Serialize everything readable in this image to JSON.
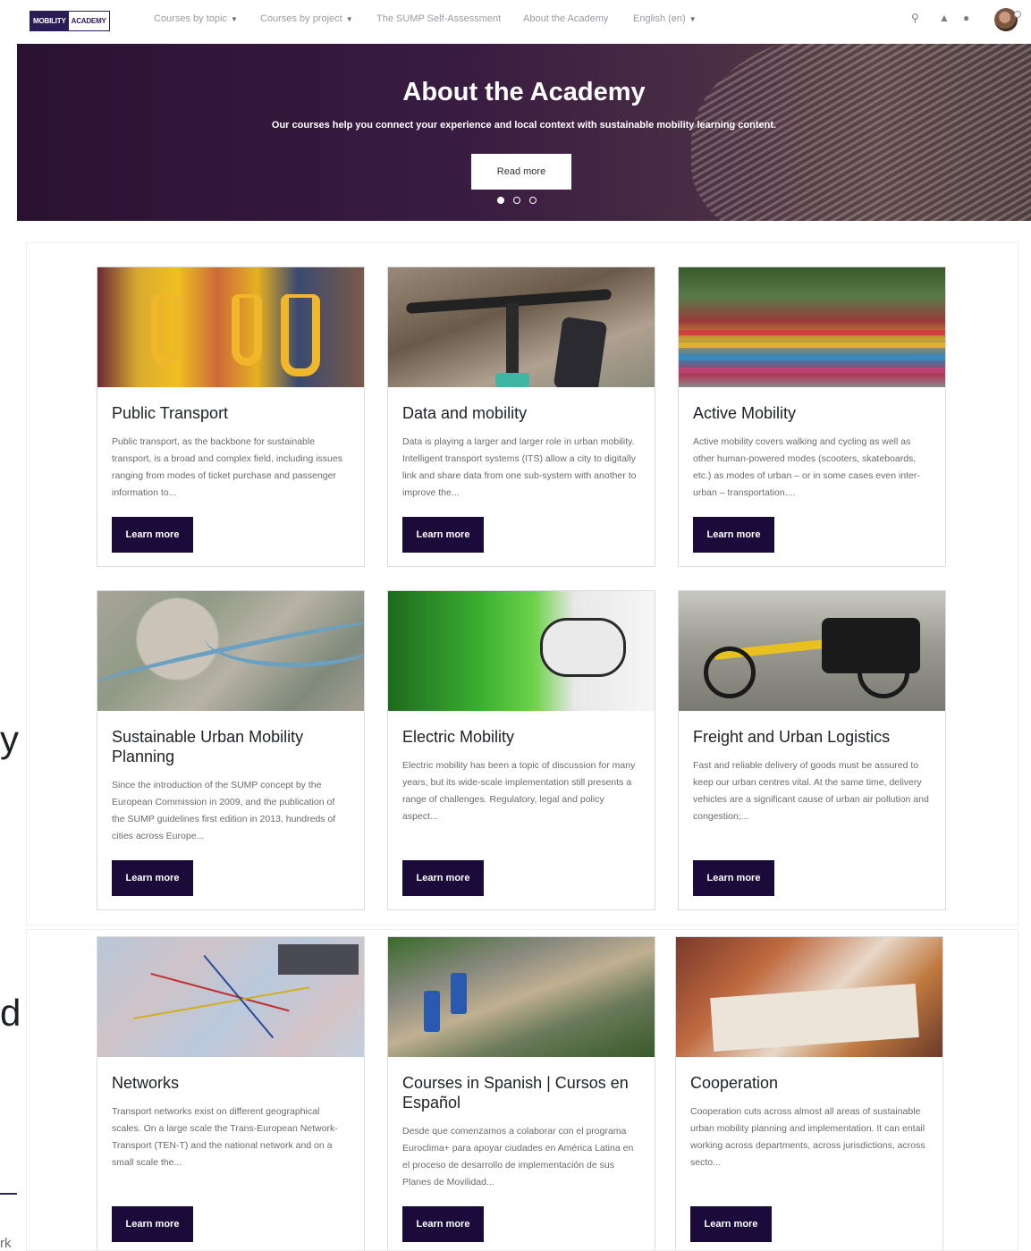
{
  "nav": {
    "logo_part1": "MOBILITY",
    "logo_part2": "ACADEMY",
    "items": [
      {
        "label": "Courses by topic",
        "caret": "▼"
      },
      {
        "label": "Courses by project",
        "caret": "▼"
      },
      {
        "label": "The SUMP Self-Assessment"
      },
      {
        "label": "About the Academy"
      },
      {
        "label": "English (en)",
        "caret": "▼"
      }
    ],
    "icons": [
      "search-icon",
      "bell-icon",
      "chat-icon"
    ]
  },
  "hero": {
    "title": "About the Academy",
    "subtitle": "Our courses help you connect your experience and local context with sustainable mobility learning content.",
    "button": "Read more",
    "slides": 3,
    "active_slide": 1
  },
  "courses": [
    {
      "title": "Public Transport",
      "description": "Public transport, as the backbone for sustainable transport, is a broad and complex field, including issues ranging from modes of ticket purchase and passenger information to...",
      "button": "Learn more"
    },
    {
      "title": "Data and mobility",
      "description": "Data is playing a larger and larger role in urban mobility. Intelligent transport systems (ITS) allow a city to digitally link and share data from one sub-system with another to improve the...",
      "button": "Learn more"
    },
    {
      "title": "Active Mobility",
      "description": "Active mobility covers walking and cycling as well as other human-powered modes (scooters, skateboards, etc.) as modes of urban – or in some cases even inter-urban – transportation....",
      "button": "Learn more"
    },
    {
      "title": "Sustainable Urban Mobility Planning",
      "description": "Since the introduction of the SUMP concept by the European Commission in 2009, and the publication of the SUMP guidelines first edition in 2013, hundreds of cities across Europe...",
      "button": "Learn more"
    },
    {
      "title": "Electric Mobility",
      "description": "Electric mobility has been a topic of discussion for many years, but its wide-scale implementation still presents a range of challenges. Regulatory, legal and policy aspect...",
      "button": "Learn more"
    },
    {
      "title": "Freight and Urban Logistics",
      "description": "Fast and reliable delivery of goods must be assured to keep our urban centres vital. At the same time, delivery vehicles are a significant cause of urban air pollution and congestion;...",
      "button": "Learn more"
    },
    {
      "title": "Networks",
      "description": "Transport networks exist on different geographical scales. On a large scale the Trans-European Network-Transport (TEN-T) and the national network and on a small scale the...",
      "button": "Learn more"
    },
    {
      "title": "Courses in Spanish | Cursos en Español",
      "description": "Desde que comenzamos a colaborar con el programa Euroclima+ para apoyar ciudades en América Latina en el proceso de desarrollo de implementación de sus Planes de Movilidad...",
      "button": "Learn more"
    },
    {
      "title": "Cooperation",
      "description": "Cooperation cuts across almost all areas of sustainable urban mobility planning and implementation. It can entail working across departments, across jurisdictions, across secto...",
      "button": "Learn more"
    }
  ],
  "edge_fragments": [
    "y",
    "d",
    "rk"
  ]
}
